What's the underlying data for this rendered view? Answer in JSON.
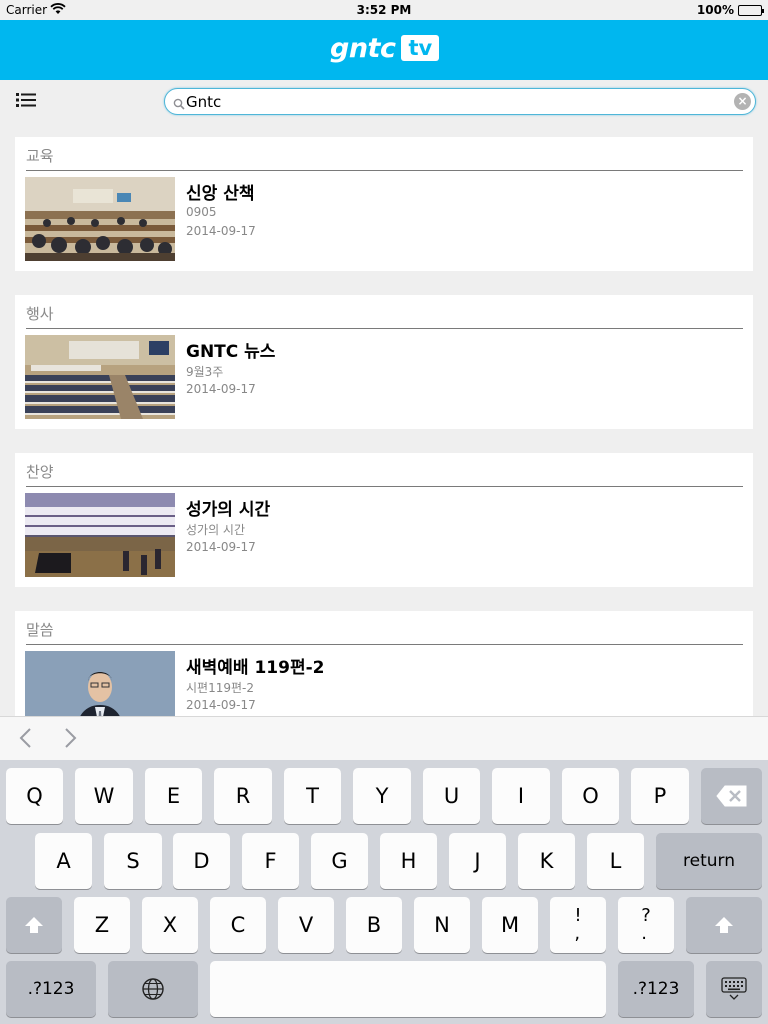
{
  "status_bar": {
    "carrier": "Carrier",
    "time": "3:52 PM",
    "battery": "100%"
  },
  "header": {
    "logo_word": "gntc",
    "logo_badge": "tv",
    "brand_color": "#00b7ef"
  },
  "search": {
    "value": "Gntc"
  },
  "cards": [
    {
      "category": "교육",
      "title": "신앙 산책",
      "subtitle": "0905",
      "date": "2014-09-17"
    },
    {
      "category": "행사",
      "title": "GNTC 뉴스",
      "subtitle": "9월3주",
      "date": "2014-09-17"
    },
    {
      "category": "찬양",
      "title": "성가의 시간",
      "subtitle": "성가의 시간",
      "date": "2014-09-17"
    },
    {
      "category": "말씀",
      "title": "새벽예배 119편-2",
      "subtitle": "시편119편-2",
      "date": "2014-09-17"
    }
  ],
  "keyboard": {
    "row1": [
      "Q",
      "W",
      "E",
      "R",
      "T",
      "Y",
      "U",
      "I",
      "O",
      "P"
    ],
    "row2": [
      "A",
      "S",
      "D",
      "F",
      "G",
      "H",
      "J",
      "K",
      "L"
    ],
    "row3": [
      "Z",
      "X",
      "C",
      "V",
      "B",
      "N",
      "M",
      "!,",
      "?."
    ],
    "return_label": "return",
    "numbers_label": ".?123"
  }
}
